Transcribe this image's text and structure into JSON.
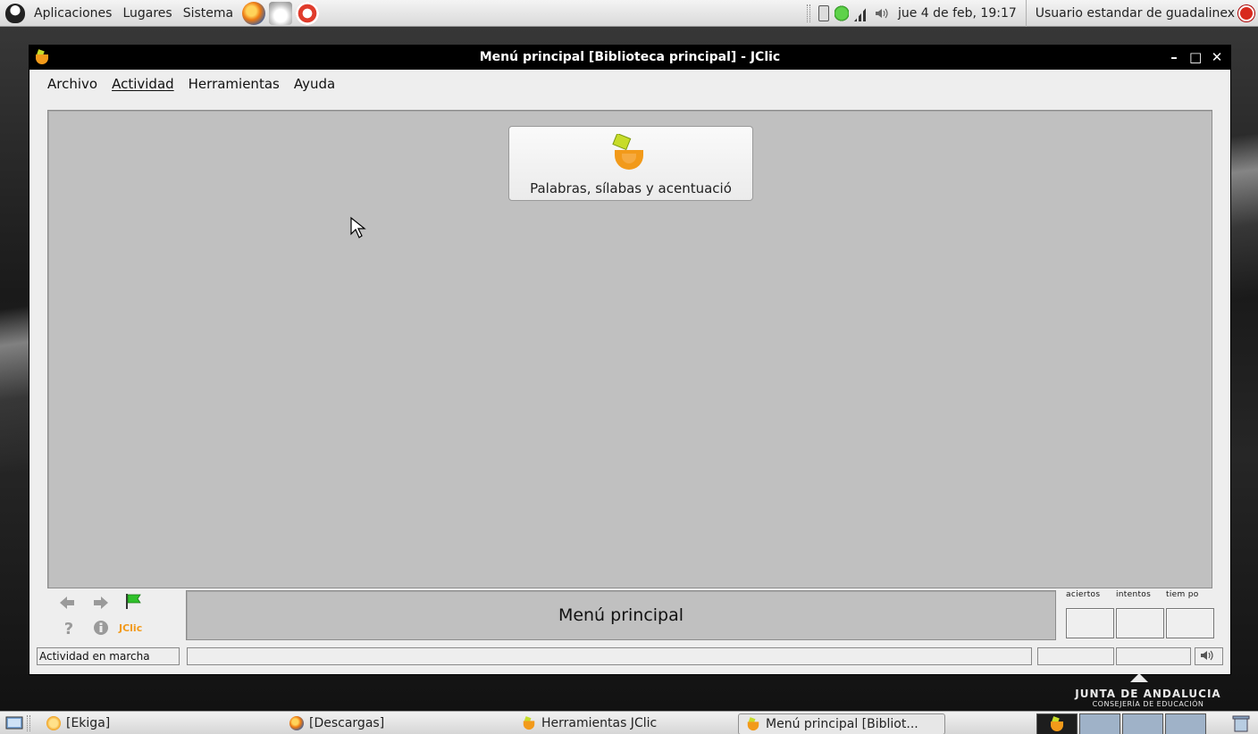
{
  "top_panel": {
    "menus": [
      "Aplicaciones",
      "Lugares",
      "Sistema"
    ],
    "clock": "jue  4 de feb, 19:17",
    "user": "Usuario estandar de guadalinex"
  },
  "window": {
    "title": "Menú principal [Biblioteca principal] - JClic",
    "menubar": {
      "archivo": "Archivo",
      "actividad": "Actividad",
      "herramientas": "Herramientas",
      "ayuda": "Ayuda"
    },
    "activity_tile": {
      "label": "Palabras, sílabas y acentuació"
    },
    "message": "Menú principal",
    "counters": {
      "aciertos": "aciertos",
      "intentos": "intentos",
      "tiempo": "tiem po"
    },
    "status": "Actividad en marcha",
    "nav": {
      "jclic_logo": "JClic"
    }
  },
  "branding": {
    "name": "JUNTA DE ANDALUCIA",
    "sub": "CONSEJERÍA DE EDUCACIÓN"
  },
  "taskbar": {
    "tasks": [
      "[Ekiga]",
      "[Descargas]",
      "Herramientas JClic",
      "Menú principal [Bibliot..."
    ]
  },
  "colors": {
    "stage_bg": "#c0c0c0",
    "titlebar_bg": "#000000",
    "jclic_orange": "#f29a1a",
    "flag_green": "#2fc12a"
  }
}
